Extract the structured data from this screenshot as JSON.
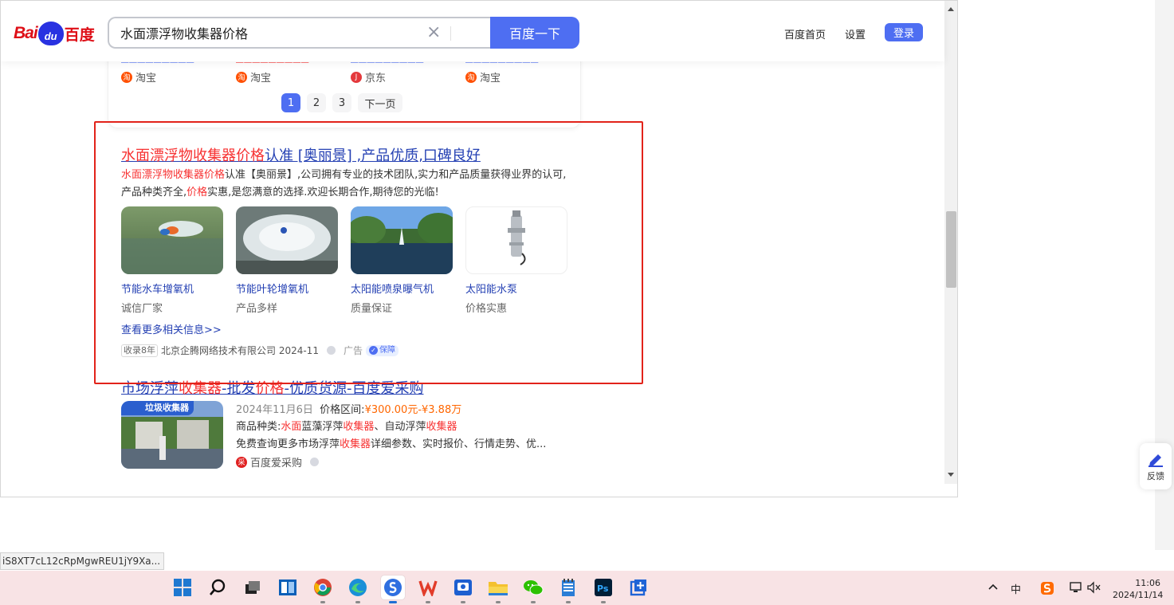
{
  "header": {
    "logo_text_bai": "Bai",
    "logo_text_du": "du",
    "logo_text_cn": "百度",
    "search_value": "水面漂浮物收集器价格",
    "search_button": "百度一下",
    "links": [
      "百度首页",
      "设置"
    ],
    "login": "登录"
  },
  "shopping": {
    "sources": [
      "淘宝",
      "淘宝",
      "京东",
      "淘宝"
    ],
    "pagination": [
      "1",
      "2",
      "3",
      "下一页"
    ],
    "current_page": "1"
  },
  "ad_result": {
    "title_highlight": "水面漂浮物收集器价格",
    "title_rest": "认准 [奥丽景] ,产品优质,口碑良好",
    "desc_highlight": "水面漂浮物收集器价格",
    "desc_part1": "认准【奥丽景】,公司拥有专业的技术团队,实力和产品质量获得业界的认可,产品种类齐全,",
    "desc_highlight2": "价格",
    "desc_part2": "实惠,是您满意的选择.欢迎长期合作,期待您的光临!",
    "products": [
      {
        "name": "节能水车增氧机",
        "sub": "诚信厂家"
      },
      {
        "name": "节能叶轮增氧机",
        "sub": "产品多样"
      },
      {
        "name": "太阳能喷泉曝气机",
        "sub": "质量保证"
      },
      {
        "name": "太阳能水泵",
        "sub": "价格实惠"
      }
    ],
    "more_link": "查看更多相关信息>>",
    "meta_tag": "收录8年",
    "meta_company": "北京企腾网络技术有限公司 2024-11",
    "meta_ad": "广告",
    "meta_badge": "保障"
  },
  "result2": {
    "title_p1": "市场浮萍",
    "title_h1": "收集器",
    "title_p2": "-批发",
    "title_h2": "价格",
    "title_p3": "-优质货源-百度爱采购",
    "image_tag": "垃圾收集器",
    "date": "2024年11月6日",
    "price_label": "价格区间:",
    "price_value": "¥300.00元-¥3.88万",
    "cat_label": "商品种类:",
    "cat_h1": "水面",
    "cat_p1": "蓝藻浮萍",
    "cat_h2": "收集器",
    "cat_p2": "、自动浮萍",
    "cat_h3": "收集器",
    "desc_p1": "免费查询更多市场浮萍",
    "desc_h": "收集器",
    "desc_p2": "详细参数、实时报价、行情走势、优...",
    "source": "百度爱采购"
  },
  "feedback": "反馈",
  "status_url": "iS8XT7cL12cRpMgwREU1jY9Xa...",
  "taskbar": {
    "tray_ime": "中",
    "time": "11:06",
    "date": "2024/11/14"
  },
  "colors": {
    "accent": "#4e6ef2",
    "link": "#2440b3",
    "highlight": "#f73131",
    "annotation_box": "#e2231a"
  }
}
